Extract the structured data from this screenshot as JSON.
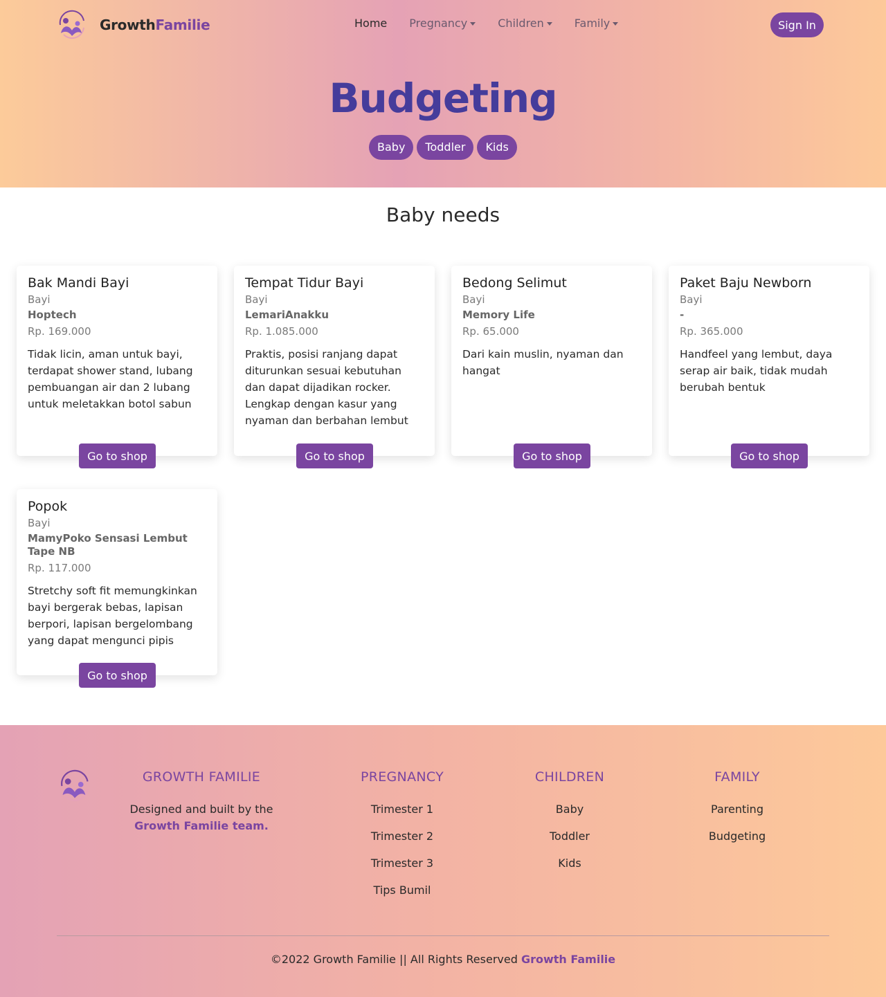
{
  "header": {
    "brand_part1": "Growth",
    "brand_part2": "Familie",
    "nav": {
      "home": "Home",
      "pregnancy": "Pregnancy",
      "children": "Children",
      "family": "Family"
    },
    "sign_in": "Sign In"
  },
  "hero": {
    "title": "Budgeting",
    "tabs": [
      "Baby",
      "Toddler",
      "Kids"
    ]
  },
  "section": {
    "title": "Baby needs"
  },
  "products": [
    {
      "name": "Bak Mandi Bayi",
      "category": "Bayi",
      "brand": "Hoptech",
      "price": "Rp. 169.000",
      "description": "Tidak licin, aman untuk bayi, terdapat shower stand, lubang pembuangan air dan 2 lubang untuk meletakkan botol sabun",
      "button": "Go to shop"
    },
    {
      "name": "Tempat Tidur Bayi",
      "category": "Bayi",
      "brand": "LemariAnakku",
      "price": "Rp. 1.085.000",
      "description": "Praktis, posisi ranjang dapat diturunkan sesuai kebutuhan dan dapat dijadikan rocker. Lengkap dengan kasur yang nyaman dan berbahan lembut",
      "button": "Go to shop"
    },
    {
      "name": "Bedong Selimut",
      "category": "Bayi",
      "brand": "Memory Life",
      "price": "Rp. 65.000",
      "description": "Dari kain muslin, nyaman dan hangat",
      "button": "Go to shop"
    },
    {
      "name": "Paket Baju Newborn",
      "category": "Bayi",
      "brand": "-",
      "price": "Rp. 365.000",
      "description": "Handfeel yang lembut, daya serap air baik, tidak mudah berubah bentuk",
      "button": "Go to shop"
    },
    {
      "name": "Popok",
      "category": "Bayi",
      "brand": "MamyPoko Sensasi Lembut Tape NB",
      "price": "Rp. 117.000",
      "description": "Stretchy soft fit memungkinkan bayi bergerak bebas, lapisan berpori, lapisan bergelombang yang dapat mengunci pipis",
      "button": "Go to shop"
    }
  ],
  "footer": {
    "about": {
      "heading": "GROWTH FAMILIE",
      "text": "Designed and built by the",
      "team": "Growth Familie team."
    },
    "pregnancy": {
      "heading": "PREGNANCY",
      "links": [
        "Trimester 1",
        "Trimester 2",
        "Trimester 3",
        "Tips Bumil"
      ]
    },
    "children": {
      "heading": "CHILDREN",
      "links": [
        "Baby",
        "Toddler",
        "Kids"
      ]
    },
    "family": {
      "heading": "FAMILY",
      "links": [
        "Parenting",
        "Budgeting"
      ]
    },
    "copyright": "©2022 Growth Familie || All Rights Reserved",
    "copyright_brand": "Growth Familie"
  },
  "colors": {
    "accent": "#7a45a0",
    "title": "#453c9b"
  }
}
